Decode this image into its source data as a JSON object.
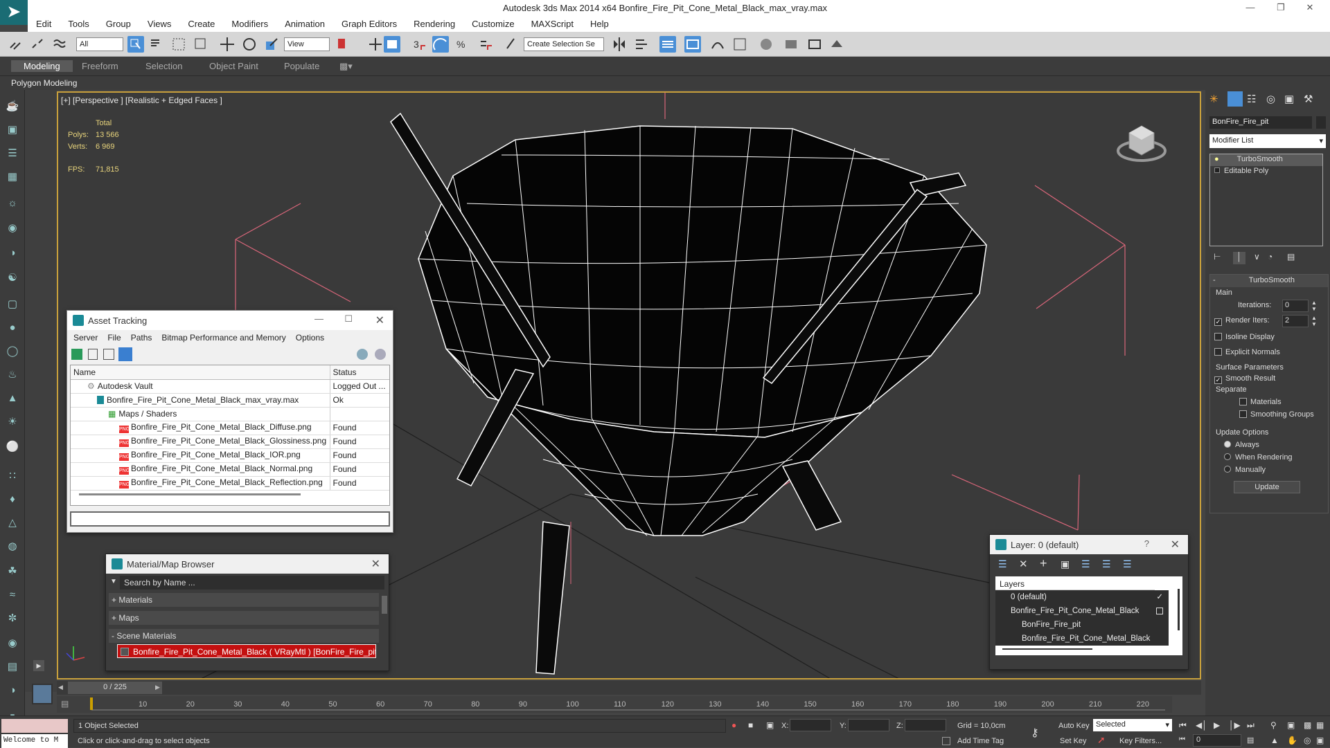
{
  "window": {
    "title": "Autodesk 3ds Max  2014 x64      Bonfire_Fire_Pit_Cone_Metal_Black_max_vray.max"
  },
  "menu": [
    "Edit",
    "Tools",
    "Group",
    "Views",
    "Create",
    "Modifiers",
    "Animation",
    "Graph Editors",
    "Rendering",
    "Customize",
    "MAXScript",
    "Help"
  ],
  "toolbar": {
    "selection_filter": "All",
    "ref_coord": "View",
    "named_selection": "Create Selection Se"
  },
  "ribbon": {
    "tabs": [
      "Modeling",
      "Freeform",
      "Selection",
      "Object Paint",
      "Populate"
    ],
    "active": "Modeling",
    "sub": "Polygon Modeling"
  },
  "viewport": {
    "label": "[+] [Perspective ] [Realistic + Edged Faces ]",
    "stats": {
      "total_label": "Total",
      "polys_label": "Polys:",
      "polys": "13 566",
      "verts_label": "Verts:",
      "verts": "6 969",
      "fps_label": "FPS:",
      "fps": "71,815"
    }
  },
  "command_panel": {
    "object_name": "BonFire_Fire_pit",
    "modifier_list": "Modifier List",
    "stack": [
      "TurboSmooth",
      "Editable Poly"
    ],
    "rollout_title": "TurboSmooth",
    "main_label": "Main",
    "iterations_label": "Iterations:",
    "iterations": "0",
    "render_iters_label": "Render Iters:",
    "render_iters": "2",
    "isoline": "Isoline Display",
    "explicit": "Explicit Normals",
    "surface_label": "Surface Parameters",
    "smooth_result": "Smooth Result",
    "separate_label": "Separate",
    "materials": "Materials",
    "smoothing_groups": "Smoothing Groups",
    "update_label": "Update Options",
    "always": "Always",
    "when_rendering": "When Rendering",
    "manually": "Manually",
    "update_button": "Update"
  },
  "asset_tracking": {
    "title": "Asset Tracking",
    "menu": [
      "Server",
      "File",
      "Paths",
      "Bitmap Performance and Memory",
      "Options"
    ],
    "col_name": "Name",
    "col_status": "Status",
    "rows": [
      {
        "name": "Autodesk Vault",
        "status": "Logged Out ..."
      },
      {
        "name": "Bonfire_Fire_Pit_Cone_Metal_Black_max_vray.max",
        "status": "Ok"
      },
      {
        "name": "Maps / Shaders",
        "status": ""
      },
      {
        "name": "Bonfire_Fire_Pit_Cone_Metal_Black_Diffuse.png",
        "status": "Found"
      },
      {
        "name": "Bonfire_Fire_Pit_Cone_Metal_Black_Glossiness.png",
        "status": "Found"
      },
      {
        "name": "Bonfire_Fire_Pit_Cone_Metal_Black_IOR.png",
        "status": "Found"
      },
      {
        "name": "Bonfire_Fire_Pit_Cone_Metal_Black_Normal.png",
        "status": "Found"
      },
      {
        "name": "Bonfire_Fire_Pit_Cone_Metal_Black_Reflection.png",
        "status": "Found"
      }
    ]
  },
  "material_browser": {
    "title": "Material/Map Browser",
    "search_placeholder": "Search by Name ...",
    "materials": "+ Materials",
    "maps": "+ Maps",
    "scene_materials": "- Scene Materials",
    "item": "Bonfire_Fire_Pit_Cone_Metal_Black ( VRayMtl ) [BonFire_Fire_pit]"
  },
  "layer_dialog": {
    "title": "Layer: 0 (default)",
    "help": "?",
    "header": "Layers",
    "rows": [
      "0 (default)",
      "Bonfire_Fire_Pit_Cone_Metal_Black",
      "BonFire_Fire_pit",
      "Bonfire_Fire_Pit_Cone_Metal_Black"
    ]
  },
  "timeline": {
    "frame": "0 / 225",
    "ticks": [
      "10",
      "20",
      "30",
      "40",
      "50",
      "60",
      "70",
      "80",
      "90",
      "100",
      "110",
      "120",
      "130",
      "140",
      "150",
      "160",
      "170",
      "180",
      "190",
      "200",
      "210",
      "220"
    ]
  },
  "status": {
    "maxscript": "Welcome to M",
    "selected": "1 Object Selected",
    "prompt": "Click or click-and-drag to select objects",
    "x_label": "X:",
    "y_label": "Y:",
    "z_label": "Z:",
    "grid": "Grid = 10,0cm",
    "auto_key": "Auto Key",
    "set_key": "Set Key",
    "key_mode": "Selected",
    "key_filters": "Key Filters...",
    "add_time_tag": "Add Time Tag",
    "frame_field": "0"
  }
}
